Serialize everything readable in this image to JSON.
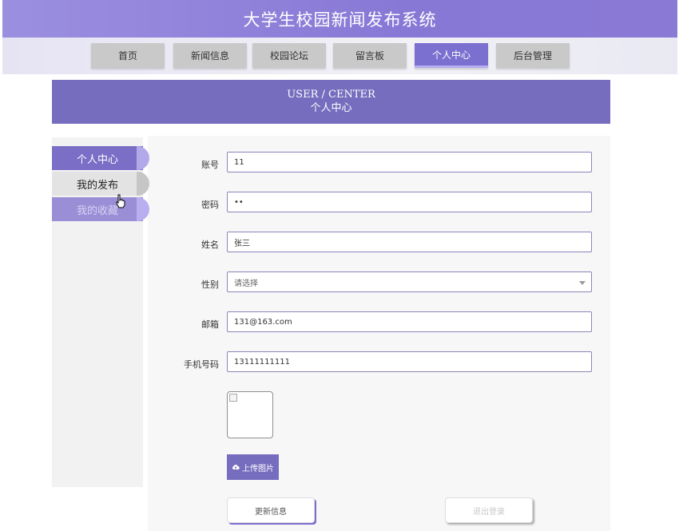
{
  "header": {
    "title": "大学生校园新闻发布系统"
  },
  "nav": {
    "items": [
      {
        "label": "首页"
      },
      {
        "label": "新闻信息"
      },
      {
        "label": "校园论坛"
      },
      {
        "label": "留言板"
      },
      {
        "label": "个人中心",
        "active": true
      },
      {
        "label": "后台管理"
      }
    ]
  },
  "banner": {
    "title_en": "USER / CENTER",
    "title_cn": "个人中心"
  },
  "sidebar": {
    "items": [
      {
        "label": "个人中心"
      },
      {
        "label": "我的发布"
      },
      {
        "label": "我的收藏"
      }
    ]
  },
  "form": {
    "account_label": "账号",
    "account_value": "11",
    "password_label": "密码",
    "password_value": "••",
    "name_label": "姓名",
    "name_value": "张三",
    "gender_label": "性别",
    "gender_placeholder": "请选择",
    "email_label": "邮箱",
    "email_value": "131@163.com",
    "phone_label": "手机号码",
    "phone_value": "13111111111",
    "upload_label": "上传图片",
    "update_label": "更新信息",
    "logout_label": "退出登录"
  },
  "colors": {
    "accent": "#776dbf",
    "active_nav": "#7b6fd0",
    "nav_inactive": "#c9c9c9"
  },
  "icons": {
    "upload": "cloud-upload-icon",
    "cursor": "hand-pointer-icon",
    "broken_image": "broken-image-icon"
  }
}
